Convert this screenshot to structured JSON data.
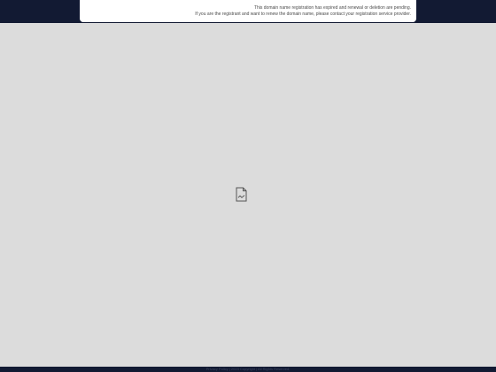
{
  "notice": {
    "line1": "This domain name registration has expired and renewal or deletion are pending.",
    "line2": "If you are the registrant and want to renew the domain name, please contact your registration service provider."
  },
  "main": {
    "image_icon": "broken-image-icon"
  },
  "footer": {
    "privacy_label": "Privacy Policy",
    "separator": "|",
    "copyright": "2023 Copyright | All Rights Reserved."
  },
  "colors": {
    "header_bg": "#121a33",
    "page_bg": "#dcdcdc",
    "card_bg": "#ffffff",
    "footer_bg": "#121a33"
  }
}
